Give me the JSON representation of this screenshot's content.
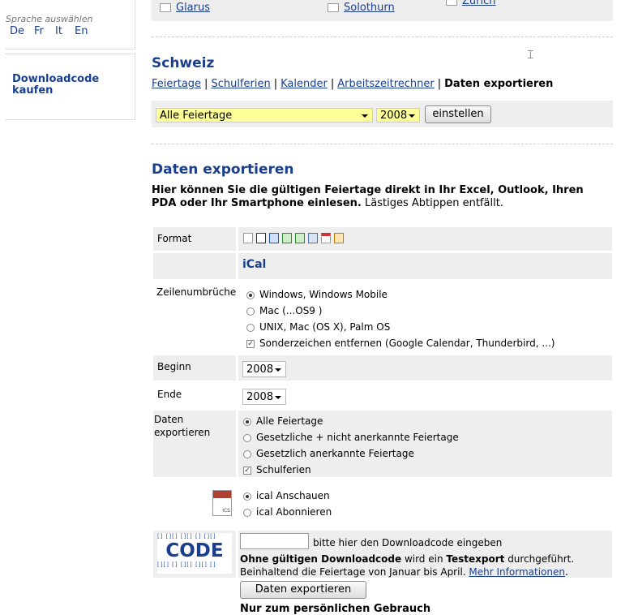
{
  "sidebar": {
    "language_label": "Sprache auswählen",
    "languages": [
      "De",
      "Fr",
      "It",
      "En"
    ],
    "download_code_link": "Downloadcode kaufen"
  },
  "top_strip": {
    "cantons": [
      "Glarus",
      "Solothurn",
      "Zürich"
    ]
  },
  "page_title": "Schweiz",
  "subnav": {
    "links": [
      "Feiertage",
      "Schulferien",
      "Kalender",
      "Arbeitszeitrechner"
    ],
    "separator": "|",
    "current": "Daten exportieren"
  },
  "filter": {
    "holiday_select": "Alle Feiertage",
    "year_select": "2008",
    "apply_button": "einstellen"
  },
  "section_title": "Daten exportieren",
  "intro": {
    "bold": "Hier können Sie die gültigen Feiertage direkt in Ihr Excel, Outlook, Ihren PDA oder Ihr Smartphone einlesen.",
    "normal": "Lästiges Abtippen entfällt."
  },
  "form": {
    "format_label": "Format",
    "format_icons": [
      "txt-icon",
      "word-icon",
      "word-doc-icon",
      "excel-icon",
      "excel-table-icon",
      "calendar-grid-icon",
      "pdf-icon",
      "xml-icon"
    ],
    "selected_format": "iCal",
    "linebreak_label": "Zeilenumbrüche",
    "linebreak_options": [
      "Windows, Windows Mobile",
      "Mac (...OS9 )",
      "UNIX, Mac (OS X), Palm OS"
    ],
    "remove_special": "Sonderzeichen entfernen (Google Calendar, Thunderbird, ...)",
    "begin_label": "Beginn",
    "begin_value": "2008",
    "end_label": "Ende",
    "end_value": "2008",
    "export_label_1": "Daten",
    "export_label_2": "exportieren",
    "export_options": [
      "Alle Feiertage",
      "Gesetzliche + nicht anerkannte Feiertage",
      "Gesetzlich anerkannte Feiertage"
    ],
    "school_holidays": "Schulferien",
    "ical_file_label": "ICS",
    "ical_options": [
      "ical Anschauen",
      "ical Abonnieren"
    ],
    "code_logo": "CODE",
    "code_hint": "bitte hier den Downloadcode eingeben",
    "notice_b1": "Ohne gültigen Downloadcode",
    "notice_t1": " wird ein ",
    "notice_b2": "Testexport",
    "notice_t2": " durchgeführt. Beinhaltend die Feiertage von Januar bis April. ",
    "notice_link": "Mehr Informationen",
    "notice_end": ".",
    "export_button": "Daten exportieren",
    "personal_use": "Nur zum persönlichen Gebrauch"
  }
}
